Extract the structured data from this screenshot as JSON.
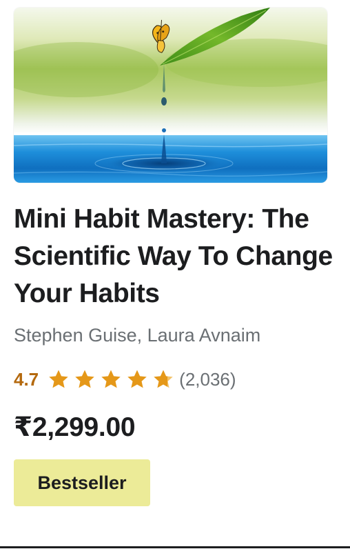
{
  "course": {
    "thumbnail_alt": "butterfly on leaf with water drop",
    "title": "Mini Habit Mastery: The Scientific Way To Change Your Habits",
    "instructors": "Stephen Guise, Laura Avnaim",
    "rating": "4.7",
    "rating_stars": 4.7,
    "rating_count": "(2,036)",
    "price": "₹2,299.00",
    "badge": "Bestseller"
  },
  "colors": {
    "rating": "#b4690e",
    "star": "#e59819",
    "badge_bg": "#eceb98",
    "muted_text": "#6a6f73",
    "primary_text": "#1c1d1f"
  },
  "icons": {
    "star": "star-icon",
    "half_star": "star-half-icon"
  }
}
